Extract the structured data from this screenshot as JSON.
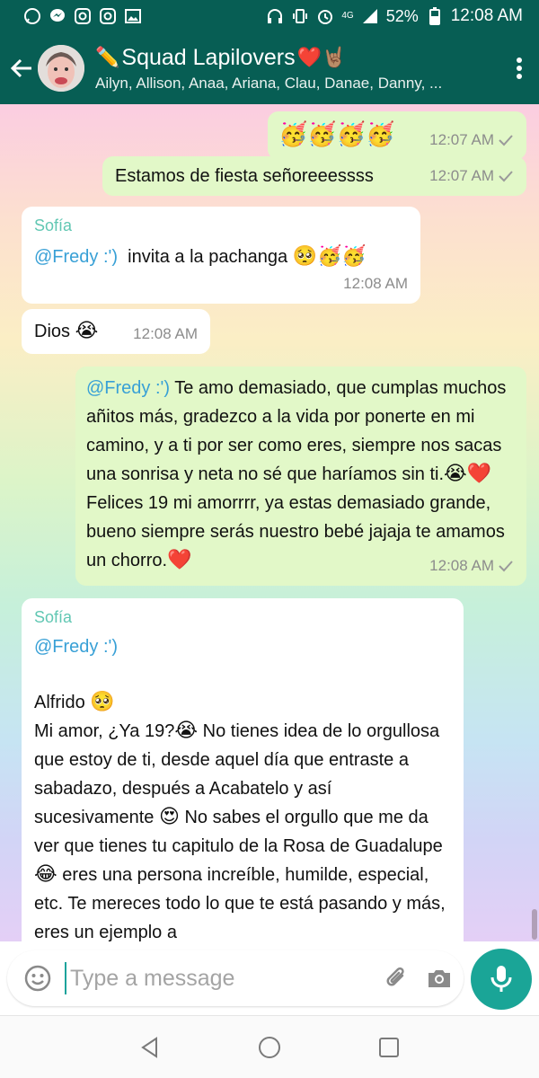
{
  "status_bar": {
    "battery": "52%",
    "time": "12:08 AM",
    "network": "4G",
    "left_icons": [
      "whatsapp-icon",
      "messenger-icon",
      "instagram-icon",
      "instagram-icon",
      "gallery-icon"
    ],
    "right_icons": [
      "headphones-icon",
      "vibrate-icon",
      "alarm-icon",
      "signal-icon",
      "battery-icon"
    ]
  },
  "header": {
    "title": "Squad Lapilovers",
    "subtitle": "Ailyn, Allison, Anaa, Ariana, Clau, Danae, Danny, ...",
    "title_prefix_emoji": "✏️",
    "title_suffix_emoji": "❤️🤘🏽"
  },
  "messages": [
    {
      "side": "out",
      "emoji_only": "🥳🥳🥳🥳",
      "time": "12:07 AM"
    },
    {
      "side": "out",
      "text": "Estamos de fiesta señoreeessss",
      "time": "12:07 AM"
    },
    {
      "side": "in",
      "sender": "Sofía",
      "mention": "@Fredy :')",
      "text": "invita a la pachanga",
      "emoji": "🥺🥳🥳",
      "time": "12:08 AM"
    },
    {
      "side": "in",
      "text": "Dios",
      "emoji": "😭",
      "time": "12:08 AM"
    },
    {
      "side": "out",
      "mention": "@Fredy :')",
      "text1": "Te amo demasiado, que cumplas muchos añitos más, gradezco a la vida por ponerte en mi camino, y a ti por ser como eres, siempre nos sacas una sonrisa y neta no sé que haríamos sin ti.",
      "emoji1": "😭❤️",
      "text2": "Felices 19 mi amorrrr, ya estas demasiado grande, bueno siempre serás nuestro bebé jajaja te amamos un chorro.",
      "emoji2": "❤️",
      "time": "12:08 AM"
    },
    {
      "side": "in",
      "sender": "Sofía",
      "mention": "@Fredy :')",
      "line_name": "Alfrido",
      "emoji_name": "🥺",
      "text_a": "Mi amor, ¿Ya 19?",
      "emoji_a": "😭",
      "text_b": "No tienes idea de lo orgullosa que estoy de ti, desde aquel día que entraste a sabadazo, después a Acabatelo y así sucesivamente",
      "emoji_b": "😍",
      "text_c": "No sabes el orgullo que me da ver que tienes tu capitulo de la Rosa de Guadalupe",
      "emoji_c": "😂",
      "text_d": "eres una persona increíble, humilde, especial, etc. Te mereces todo lo que te está pasando y más, eres un ejemplo a"
    }
  ],
  "composer": {
    "placeholder": "Type a message",
    "icons": [
      "emoji-icon",
      "attach-icon",
      "camera-icon"
    ],
    "send_icon": "microphone-icon"
  },
  "colors": {
    "primary": "#075e54",
    "outgoing_bubble": "#e2f8c8",
    "incoming_bubble": "#ffffff",
    "mention": "#38a0d6",
    "sender_name": "#61c7b3",
    "fab": "#1aa597"
  }
}
